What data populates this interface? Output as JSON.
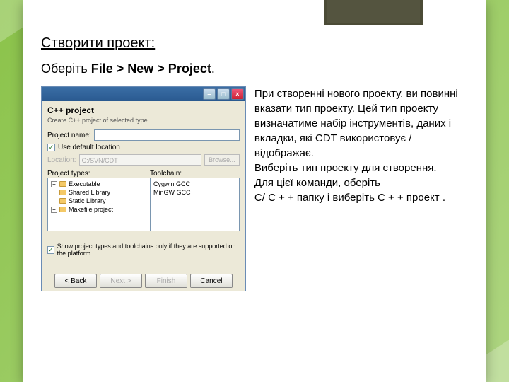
{
  "slide": {
    "heading": "Створити проект:",
    "sub_plain1": "Оберіть ",
    "sub_bold": "File > New > Project",
    "sub_plain2": "."
  },
  "dialog": {
    "title": "C++ project",
    "subtitle": "Create C++ project of selected type",
    "project_name_label": "Project name:",
    "project_name_value": "",
    "use_default_label": "Use default location",
    "location_label": "Location:",
    "location_value": "C:/SVN/CDT",
    "browse_label": "Browse...",
    "project_types_label": "Project types:",
    "toolchain_label": "Toolchain:",
    "types": [
      "Executable",
      "Shared Library",
      "Static Library",
      "Makefile project"
    ],
    "toolchains": [
      "Cygwin GCC",
      "MinGW GCC"
    ],
    "show_supported_label": "Show project types and toolchains only if they are supported on the platform",
    "buttons": {
      "back": "< Back",
      "next": "Next >",
      "finish": "Finish",
      "cancel": "Cancel"
    },
    "win": {
      "minimize": "–",
      "maximize": "□",
      "close": "×"
    }
  },
  "explain": {
    "l1": " При створенні нового  проекту, ви повинні",
    "l2": "вказати тип проекту.   Цей тип  проекту",
    "l3": " визначатиме набір інструментів, даних і",
    "l4": "вкладки, які CDT використовує / відображає.",
    "l5": "Виберіть тип проекту для створення.",
    "l6": "Для цієї команди, оберіть",
    "l7": "С/ C + + папку  і виберіть C + + проект ."
  }
}
